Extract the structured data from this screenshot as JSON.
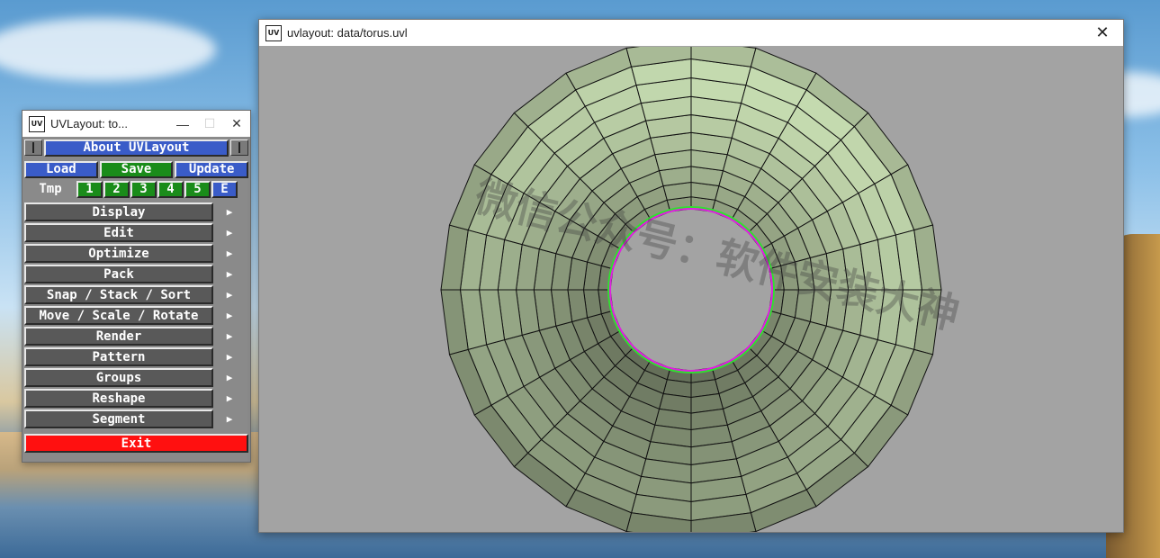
{
  "panel": {
    "title": "UVLayout: to...",
    "window_controls": {
      "minimize": "—",
      "maximize": "☐",
      "close": "✕"
    },
    "about_label": "About UVLayout",
    "load_label": "Load",
    "save_label": "Save",
    "update_label": "Update",
    "tmp_label": "Tmp",
    "tmp_slots": [
      "1",
      "2",
      "3",
      "4",
      "5",
      "E"
    ],
    "menu_items": [
      "Display",
      "Edit",
      "Optimize",
      "Pack",
      "Snap / Stack / Sort",
      "Move / Scale / Rotate",
      "Render",
      "Pattern",
      "Groups",
      "Reshape",
      "Segment"
    ],
    "submenu_arrow": "▶",
    "exit_label": "Exit"
  },
  "main_window": {
    "title": "uvlayout: data/torus.uvl",
    "close": "✕"
  },
  "app_icon_text": "UV",
  "watermark": "微信公众号：软件安装大神",
  "colors": {
    "button_blue": "#3a5cc8",
    "button_green": "#1a8c1a",
    "button_gray": "#595959",
    "button_red": "#ff1010",
    "viewport_bg": "#a3a3a3",
    "mesh_outer": "#c5dbb0",
    "mesh_inner": "#8c9a7c",
    "edge_magenta": "#e020e0",
    "edge_green": "#30e030"
  }
}
